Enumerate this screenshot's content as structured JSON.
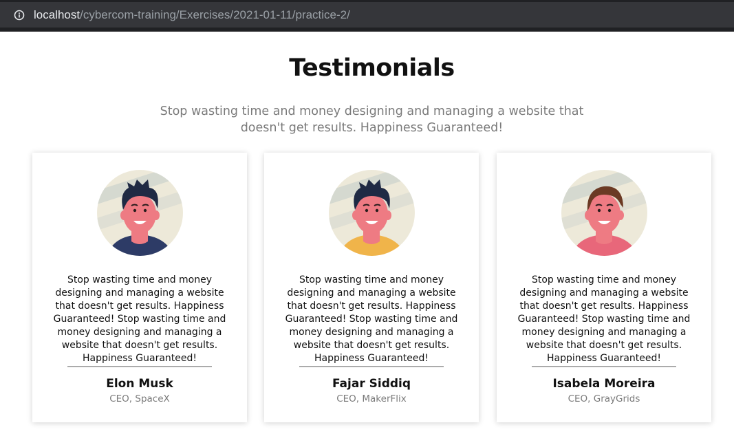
{
  "browser": {
    "url_host": "localhost",
    "url_path": "/cybercom-training/Exercises/2021-01-11/practice-2/",
    "info_icon": "info-icon"
  },
  "header": {
    "title": "Testimonials",
    "subtitle": "Stop wasting time and money designing and managing a website that doesn't get results. Happiness Guaranteed!"
  },
  "testimonials": [
    {
      "quote": "Stop wasting time and money designing and managing a website that doesn't get results. Happiness Guaranteed! Stop wasting time and money designing and managing a website that doesn't get results. Happiness Guaranteed!",
      "name": "Elon Musk",
      "role": "CEO, SpaceX",
      "hair_color": "#1f2a44",
      "shirt_color": "#2d3b66"
    },
    {
      "quote": "Stop wasting time and money designing and managing a website that doesn't get results. Happiness Guaranteed! Stop wasting time and money designing and managing a website that doesn't get results. Happiness Guaranteed!",
      "name": "Fajar Siddiq",
      "role": "CEO, MakerFlix",
      "hair_color": "#1f2a44",
      "shirt_color": "#f0b44a"
    },
    {
      "quote": "Stop wasting time and money designing and managing a website that doesn't get results. Happiness Guaranteed! Stop wasting time and money designing and managing a website that doesn't get results. Happiness Guaranteed!",
      "name": "Isabela Moreira",
      "role": "CEO, GrayGrids",
      "hair_color": "#6b3a24",
      "shirt_color": "#e8677a"
    }
  ],
  "colors": {
    "skin": "#ee7b83",
    "avatar_bg": "#ede9d9",
    "avatar_stripe": "#d5d9d0"
  }
}
